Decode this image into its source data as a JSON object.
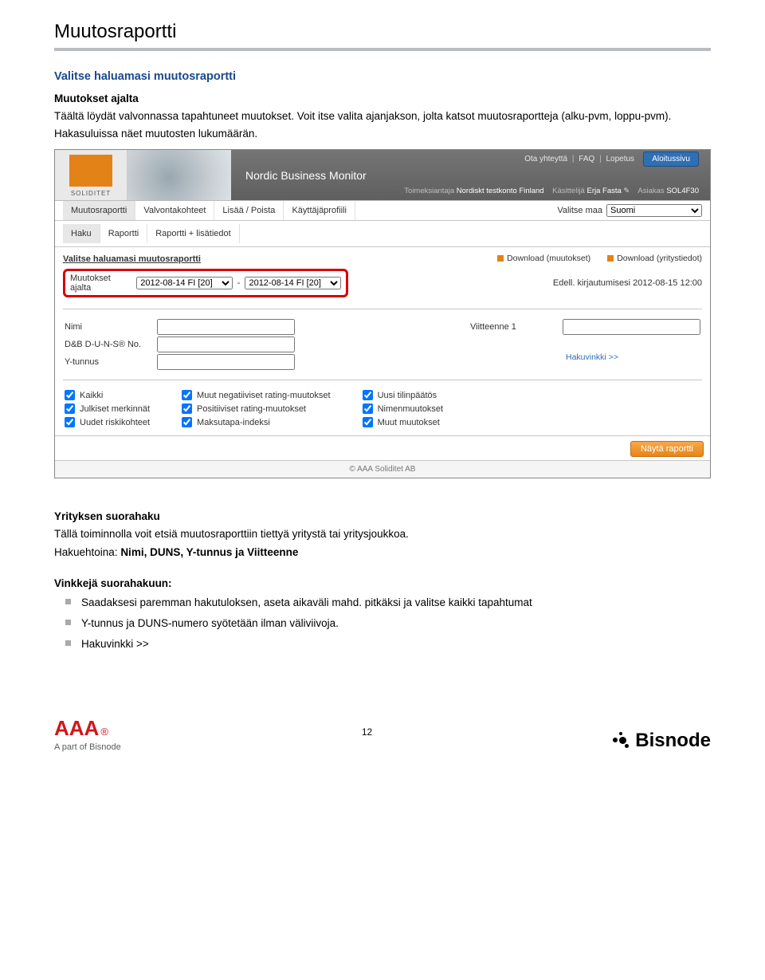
{
  "page_title": "Muutosraportti",
  "intro": {
    "heading": "Valitse haluamasi muutosraportti",
    "subheading": "Muutokset ajalta",
    "p1": "Täältä löydät valvonnassa tapahtuneet muutokset. Voit itse valita ajanjakson, jolta katsot muutosraportteja (alku-pvm, loppu-pvm).",
    "p2": "Hakasuluissa näet muutosten lukumäärän."
  },
  "shot": {
    "logo_text": "SOLIDITET",
    "app_title": "Nordic Business Monitor",
    "top_links": [
      "Ota yhteyttä",
      "FAQ",
      "Lopetus"
    ],
    "top_button": "Aloitussivu",
    "meta": {
      "org_label": "Toimeksiantaja",
      "org_value": "Nordiskt testkonto Finland",
      "user_label": "Käsittelijä",
      "user_value": "Erja Fasta",
      "cust_label": "Asiakas",
      "cust_value": "SOL4F30"
    },
    "main_tabs": [
      "Muutosraportti",
      "Valvontakohteet",
      "Lisää / Poista",
      "Käyttäjäprofiili"
    ],
    "country_label": "Valitse maa",
    "country_value": "Suomi",
    "sub_tabs": [
      "Haku",
      "Raportti",
      "Raportti + lisätiedot"
    ],
    "sec_title": "Valitse haluamasi muutosraportti",
    "downloads": {
      "d1": "Download (muutokset)",
      "d2": "Download (yritystiedot)"
    },
    "range_label": "Muutokset ajalta",
    "range_from": "2012-08-14 FI [20]",
    "range_to": "2012-08-14 FI [20]",
    "last_login_label": "Edell. kirjautumisesi",
    "last_login_value": "2012-08-15 12:00",
    "fields": {
      "nimi": "Nimi",
      "duns": "D&B D-U-N-S® No.",
      "ytunnus": "Y-tunnus",
      "viite": "Viitteenne 1",
      "hakulink": "Hakuvinkki >>"
    },
    "checks": {
      "col1": [
        "Kaikki",
        "Julkiset merkinnät",
        "Uudet riskikohteet"
      ],
      "col2": [
        "Muut negatiiviset rating-muutokset",
        "Positiiviset rating-muutokset",
        "Maksutapa-indeksi"
      ],
      "col3": [
        "Uusi tilinpäätös",
        "Nimenmuutokset",
        "Muut muutokset"
      ]
    },
    "submit_btn": "Näytä raportti",
    "footer": "© AAA Soliditet AB"
  },
  "section2": {
    "heading": "Yrityksen suorahaku",
    "p1": "Tällä toiminnolla voit etsiä muutosraporttiin tiettyä yritystä tai yritysjoukkoa.",
    "p2_prefix": "Hakuehtoina: ",
    "p2_bold": "Nimi, DUNS, Y-tunnus ja Viitteenne"
  },
  "tips": {
    "heading": "Vinkkejä suorahakuun:",
    "items": [
      "Saadaksesi paremman hakutuloksen, aseta aikaväli mahd. pitkäksi ja valitse kaikki tapahtumat",
      "Y-tunnus ja DUNS-numero syötetään ilman väliviivoja.",
      "Hakuvinkki >>"
    ]
  },
  "footer": {
    "aaa_reg": "®",
    "aaa_sub": "A part of Bisnode",
    "page_number": "12",
    "bisnode": "Bisnode"
  }
}
